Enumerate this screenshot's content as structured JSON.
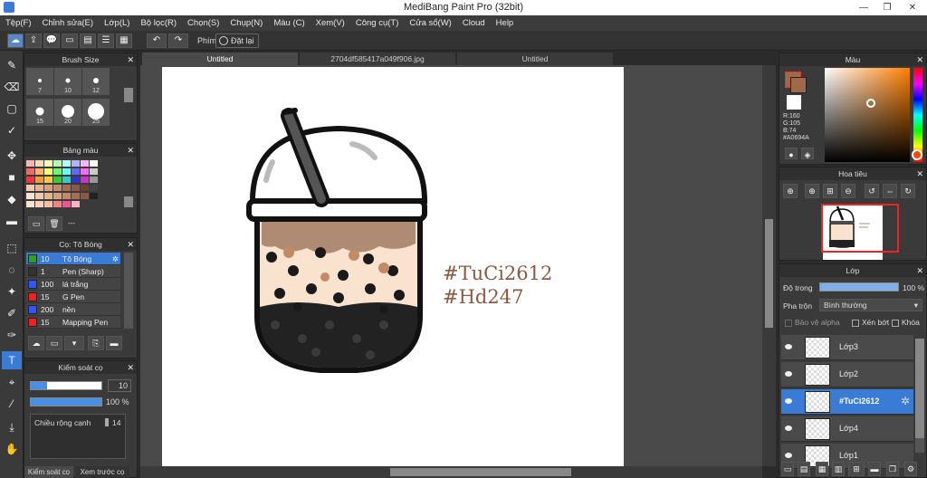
{
  "window": {
    "title": "MediBang Paint Pro (32bit)",
    "minimize": "—",
    "restore": "❐",
    "close": "✕"
  },
  "menu": [
    "Tệp(F)",
    "Chỉnh sửa(E)",
    "Lớp(L)",
    "Bộ lọc(R)",
    "Chọn(S)",
    "Chụp(N)",
    "Màu (C)",
    "Xem(V)",
    "Công cụ(T)",
    "Cửa sổ(W)",
    "Cloud",
    "Help"
  ],
  "toolbar": {
    "phim_label": "Phím",
    "reset_label": "Đặt lại"
  },
  "brush_size": {
    "title": "Brush Size",
    "sizes": [
      "7",
      "10",
      "12",
      "15",
      "20",
      "25"
    ]
  },
  "palette": {
    "title": "Bảng màu",
    "placeholder": "---"
  },
  "brush_list": {
    "title": "Cọ: Tô Bóng",
    "items": [
      {
        "size": "10",
        "name": "Tô Bóng",
        "color": "#2ca02c",
        "selected": true
      },
      {
        "size": "1",
        "name": "Pen (Sharp)",
        "color": "#333333",
        "selected": false
      },
      {
        "size": "100",
        "name": "lá trắng",
        "color": "#3355ff",
        "selected": false
      },
      {
        "size": "15",
        "name": "G Pen",
        "color": "#ee2222",
        "selected": false
      },
      {
        "size": "200",
        "name": "nền",
        "color": "#3355ff",
        "selected": false
      },
      {
        "size": "15",
        "name": "Mapping Pen",
        "color": "#ee2222",
        "selected": false
      }
    ]
  },
  "brush_control": {
    "title": "Kiểm soát cọ",
    "size_value": "10",
    "opacity_value": "100 %",
    "width_label": "Chiều rộng cạnh",
    "width_value": "14",
    "tab1": "Kiểm soát cọ",
    "tab2": "Xem trước cọ"
  },
  "tabs": [
    "Untitled",
    "2704df585417a049f906.jpg",
    "Untitled"
  ],
  "canvas": {
    "text1": "#TuCi2612",
    "text2": "#Hd247"
  },
  "color_panel": {
    "title": "Màu",
    "r": "R:160",
    "g": "G:105",
    "b": "B:74",
    "hex": "#A0694A"
  },
  "navigator": {
    "title": "Hoa tiêu"
  },
  "layer_panel": {
    "title": "Lớp",
    "opacity_label": "Độ trong",
    "opacity_value": "100 %",
    "blend_label": "Pha trộn",
    "blend_value": "Bình thường",
    "alpha_label": "Bảo vệ alpha",
    "clip_label": "Xén bớt",
    "lock_label": "Khóa",
    "layers": [
      {
        "name": "Lớp3",
        "selected": false
      },
      {
        "name": "Lớp2",
        "selected": false
      },
      {
        "name": "#TuCi2612",
        "selected": true
      },
      {
        "name": "Lớp4",
        "selected": false
      },
      {
        "name": "Lớp1",
        "selected": false
      }
    ]
  }
}
